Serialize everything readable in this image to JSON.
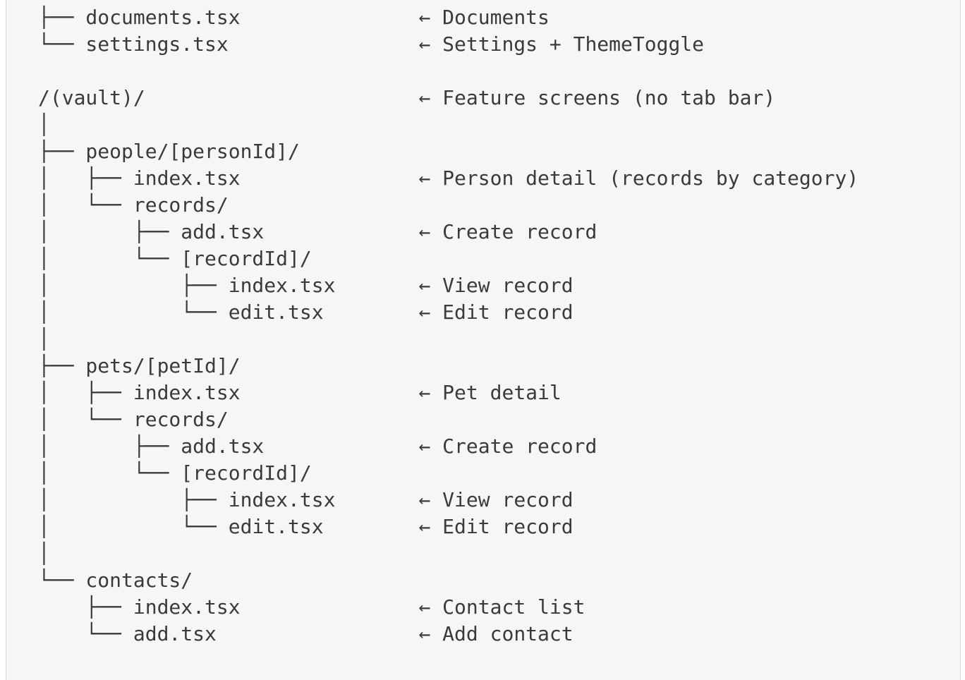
{
  "code_block": {
    "lines": [
      {
        "tree": "├── documents.tsx",
        "comment": "Documents"
      },
      {
        "tree": "└── settings.tsx",
        "comment": "Settings + ThemeToggle"
      },
      {
        "tree": "",
        "comment": ""
      },
      {
        "tree": "/(vault)/",
        "comment": "Feature screens (no tab bar)"
      },
      {
        "tree": "│",
        "comment": ""
      },
      {
        "tree": "├── people/[personId]/",
        "comment": ""
      },
      {
        "tree": "│   ├── index.tsx",
        "comment": "Person detail (records by category)"
      },
      {
        "tree": "│   └── records/",
        "comment": ""
      },
      {
        "tree": "│       ├── add.tsx",
        "comment": "Create record"
      },
      {
        "tree": "│       └── [recordId]/",
        "comment": ""
      },
      {
        "tree": "│           ├── index.tsx",
        "comment": "View record"
      },
      {
        "tree": "│           └── edit.tsx",
        "comment": "Edit record"
      },
      {
        "tree": "│",
        "comment": ""
      },
      {
        "tree": "├── pets/[petId]/",
        "comment": ""
      },
      {
        "tree": "│   ├── index.tsx",
        "comment": "Pet detail"
      },
      {
        "tree": "│   └── records/",
        "comment": ""
      },
      {
        "tree": "│       ├── add.tsx",
        "comment": "Create record"
      },
      {
        "tree": "│       └── [recordId]/",
        "comment": ""
      },
      {
        "tree": "│           ├── index.tsx",
        "comment": "View record"
      },
      {
        "tree": "│           └── edit.tsx",
        "comment": "Edit record"
      },
      {
        "tree": "│",
        "comment": ""
      },
      {
        "tree": "└── contacts/",
        "comment": ""
      },
      {
        "tree": "    ├── index.tsx",
        "comment": "Contact list"
      },
      {
        "tree": "    └── add.tsx",
        "comment": "Add contact"
      }
    ],
    "arrow": "←"
  }
}
